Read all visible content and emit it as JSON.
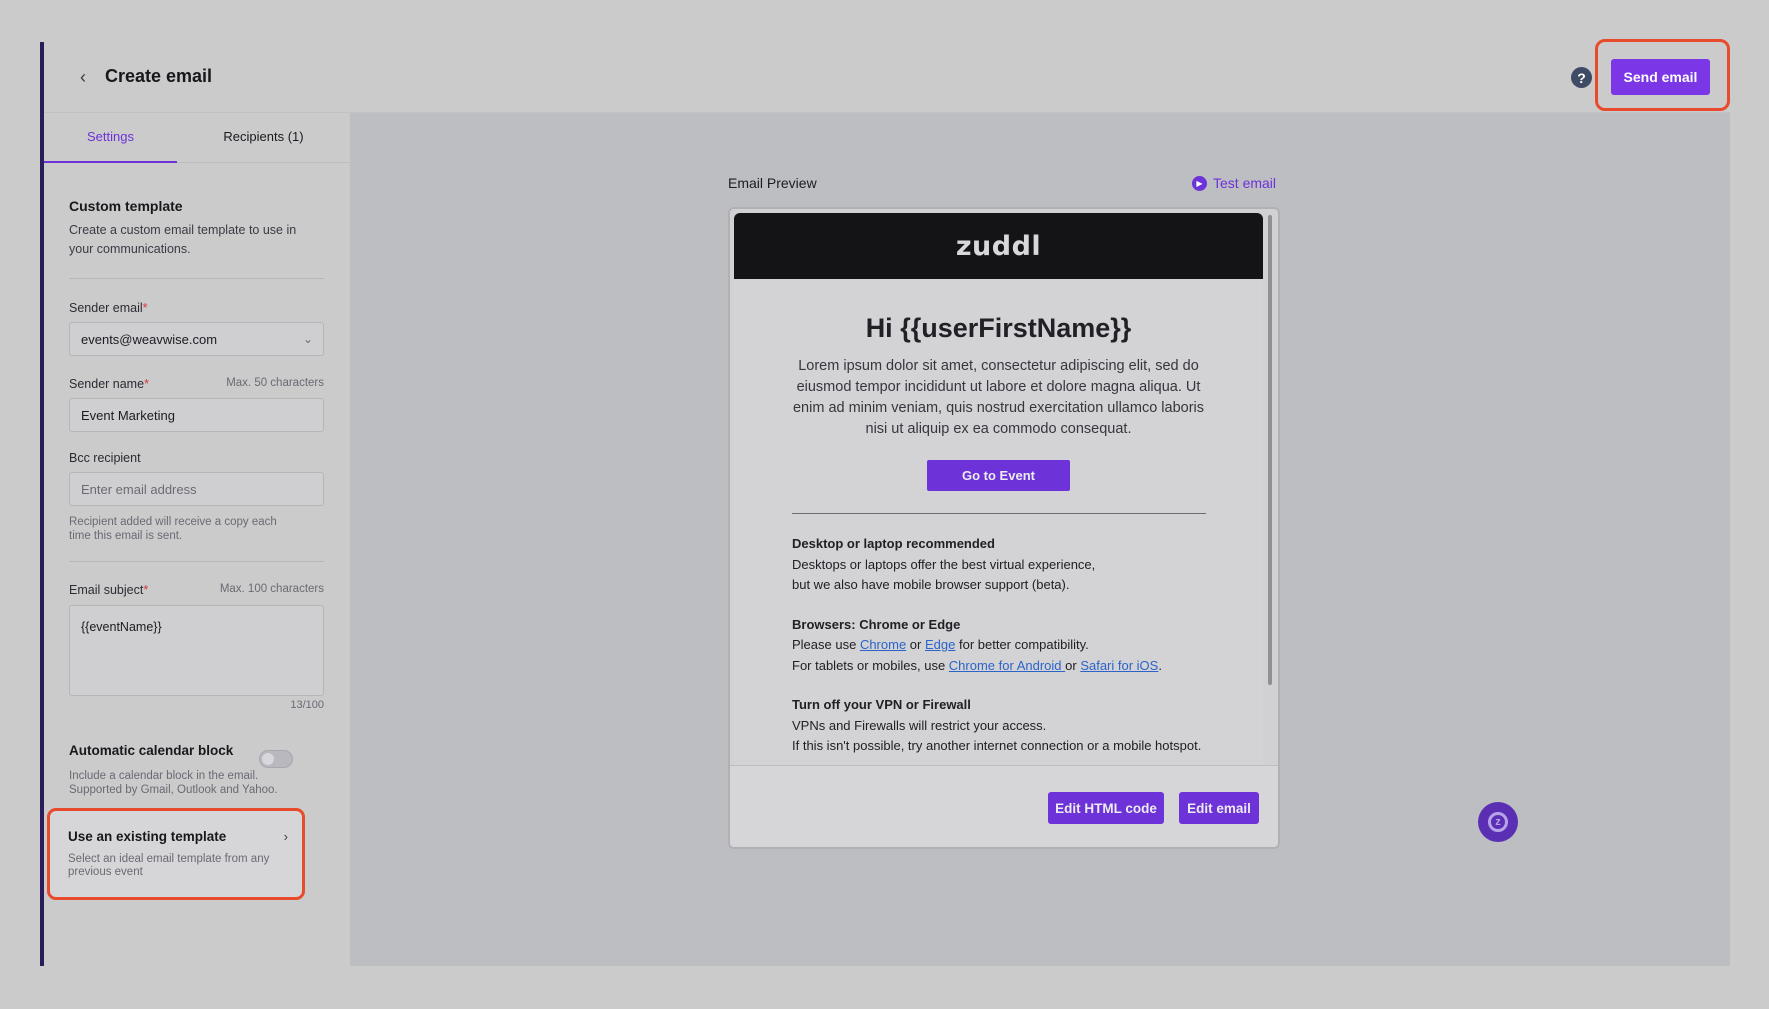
{
  "header": {
    "title": "Create email",
    "help_icon": "?",
    "send_label": "Send email"
  },
  "tabs": [
    {
      "label": "Settings",
      "active": true
    },
    {
      "label": "Recipients (1)",
      "active": false
    }
  ],
  "custom_template": {
    "title": "Custom template",
    "description": "Create a custom email template to use in your communications."
  },
  "sender_email": {
    "label": "Sender email",
    "required_mark": "*",
    "value": "events@weavwise.com"
  },
  "sender_name": {
    "label": "Sender name",
    "required_mark": "*",
    "hint": "Max. 50 characters",
    "value": "Event Marketing"
  },
  "bcc": {
    "label": "Bcc recipient",
    "placeholder": "Enter email address",
    "help": "Recipient added will receive a copy each time this email is sent."
  },
  "subject": {
    "label": "Email subject",
    "required_mark": "*",
    "hint": "Max. 100 characters",
    "value": "{{eventName}}",
    "counter": "13/100"
  },
  "calendar": {
    "title": "Automatic calendar block",
    "description": "Include a calendar block in the email. Supported by Gmail, Outlook and Yahoo.",
    "enabled": false
  },
  "existing_template": {
    "title": "Use an existing template",
    "description": "Select an ideal email template from any previous event"
  },
  "preview": {
    "label": "Email Preview",
    "test_label": "Test email",
    "logo": "zuddl",
    "greeting": "Hi {{userFirstName}}",
    "body": "Lorem ipsum dolor sit amet, consectetur adipiscing elit, sed do eiusmod tempor incididunt ut labore et dolore magna aliqua. Ut enim ad minim veniam, quis nostrud exercitation ullamco laboris nisi ut aliquip ex ea commodo consequat.",
    "cta": "Go to Event",
    "tips": {
      "t1_title": "Desktop or laptop recommended",
      "t1_line1": "Desktops or laptops offer the best virtual experience,",
      "t1_line2": "but we also have mobile browser support (beta).",
      "t2_title": "Browsers: Chrome or Edge",
      "t2_l1_a": "Please use ",
      "t2_link_chrome": "Chrome",
      "t2_l1_b": " or ",
      "t2_link_edge": "Edge",
      "t2_l1_c": " for better compatibility.",
      "t2_l2_a": "For tablets or mobiles, use ",
      "t2_link_android": "Chrome for Android ",
      "t2_l2_b": "or ",
      "t2_link_ios": "Safari for iOS",
      "t2_l2_c": ".",
      "t3_title": "Turn off your VPN or Firewall",
      "t3_line1": "VPNs and Firewalls will restrict your access.",
      "t3_line2": "If this isn't possible, try another internet connection or a mobile hotspot."
    },
    "edit_html_label": "Edit HTML code",
    "edit_email_label": "Edit email"
  },
  "colors": {
    "accent": "#6d32d8",
    "highlight": "#e84a2c"
  }
}
